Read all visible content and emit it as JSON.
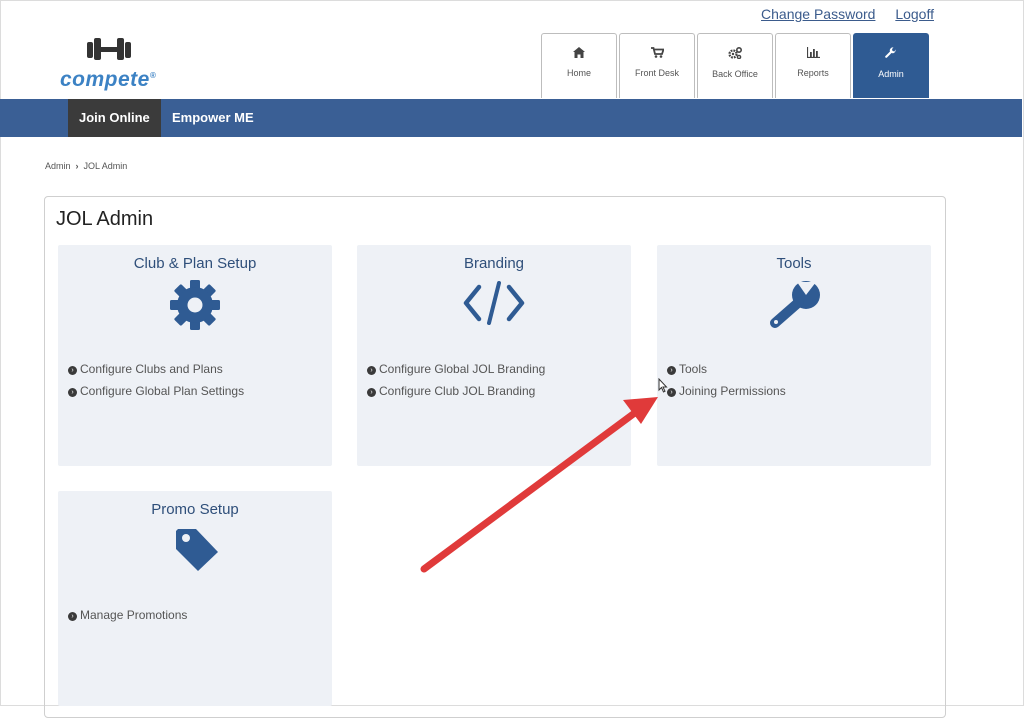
{
  "top_links": {
    "change_password": "Change Password",
    "logoff": "Logoff"
  },
  "logo": {
    "name": "compete",
    "mark": "®",
    "icon": "dumbbell-icon"
  },
  "tabs": [
    {
      "label": "Home",
      "icon": "home-icon"
    },
    {
      "label": "Front Desk",
      "icon": "cart-icon"
    },
    {
      "label": "Back Office",
      "icon": "gears-icon"
    },
    {
      "label": "Reports",
      "icon": "bar-chart-icon"
    },
    {
      "label": "Admin",
      "icon": "wrench-icon",
      "active": true
    }
  ],
  "navbar": [
    {
      "label": "Join Online",
      "active": true
    },
    {
      "label": "Empower ME"
    }
  ],
  "breadcrumb": [
    "Admin",
    "JOL Admin"
  ],
  "page_title": "JOL Admin",
  "cards": [
    {
      "title": "Club & Plan Setup",
      "icon": "gear-icon",
      "links": [
        "Configure Clubs and Plans",
        "Configure Global Plan Settings"
      ]
    },
    {
      "title": "Branding",
      "icon": "code-icon",
      "links": [
        "Configure Global JOL Branding",
        "Configure Club JOL Branding"
      ]
    },
    {
      "title": "Tools",
      "icon": "wrench-icon",
      "links": [
        "Tools",
        "Joining Permissions"
      ]
    },
    {
      "title": "Promo Setup",
      "icon": "tag-icon",
      "links": [
        "Manage Promotions"
      ]
    }
  ],
  "colors": {
    "brand_blue": "#3a5f95",
    "logo_blue": "#3c82c4",
    "card_bg": "#eef1f6",
    "annotation_arrow": "#e03a3a"
  }
}
